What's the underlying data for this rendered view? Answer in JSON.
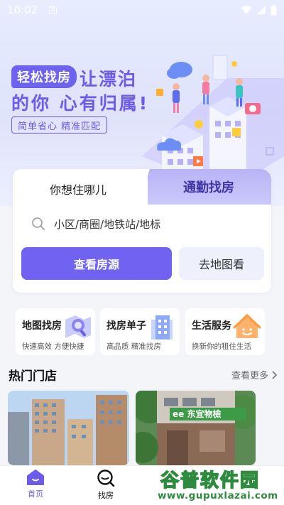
{
  "status_bar": {
    "time": "10:02",
    "sim_label": "A"
  },
  "hero": {
    "tag": "轻松找房",
    "headline_line1": "让漂泊",
    "headline_line2": "的你 心有归属!",
    "subtitle": "简单省心 精准匹配"
  },
  "search_card": {
    "tabs": [
      "你想住哪儿",
      "通勤找房"
    ],
    "active_tab": 0,
    "search_placeholder": "小区/商圈/地铁站/地标",
    "primary_button": "查看房源",
    "secondary_button": "去地图看"
  },
  "features": [
    {
      "title": "地图找房",
      "desc": "快速高效 方便快捷",
      "icon": "map-search-icon"
    },
    {
      "title": "找房单子",
      "desc": "高品质 精准找房",
      "icon": "building-list-icon"
    },
    {
      "title": "生活服务",
      "desc": "换新你的租住生活",
      "icon": "house-smile-icon"
    }
  ],
  "hot_stores": {
    "title": "热门门店",
    "more_label": "查看更多",
    "cards": [
      {
        "image": "high-rise-apartments-photo"
      },
      {
        "image": "storefront-building-photo",
        "sign_text": "ee 东宜物檢"
      }
    ]
  },
  "tab_bar": {
    "items": [
      {
        "label": "首页",
        "icon": "home-icon",
        "active": true
      },
      {
        "label": "找房",
        "icon": "search-icon",
        "active": false
      }
    ]
  },
  "watermark": {
    "line1": "谷普软件园",
    "line2": "www.gupuxlazai.com"
  },
  "colors": {
    "accent": "#7063f1",
    "headline": "#6c5ce7",
    "watermark": "#2e8b3e"
  }
}
